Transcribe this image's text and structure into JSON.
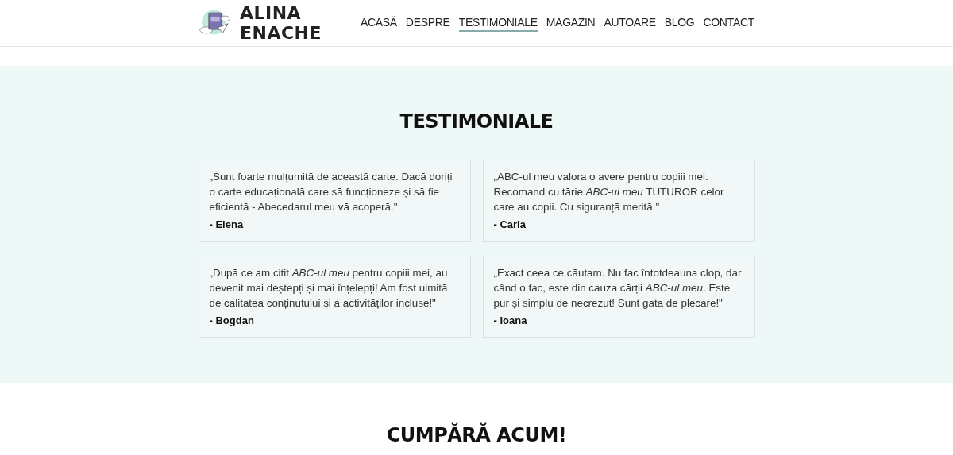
{
  "header": {
    "logo_text": "ALINA ENACHE",
    "nav": [
      {
        "label": "ACASĂ",
        "selected": false
      },
      {
        "label": "DESPRE",
        "selected": false
      },
      {
        "label": "TESTIMONIALE",
        "selected": true
      },
      {
        "label": "MAGAZIN",
        "selected": false
      },
      {
        "label": "AUTOARE",
        "selected": false
      },
      {
        "label": "BLOG",
        "selected": false
      },
      {
        "label": "CONTACT",
        "selected": false
      }
    ]
  },
  "testimonials": {
    "title": "TESTIMONIALE",
    "items": [
      {
        "quote": "„Sunt foarte mulțumită de această carte. Dacă doriți o carte educațională care să funcționeze și să fie eficientă - Abecedarul meu vă acoperă.\"",
        "author": "- Elena"
      },
      {
        "quote": "„ABC-ul meu valora o avere pentru copiii mei. Recomand cu tărie *ABC-ul meu* TUTUROR celor care au copii. Cu siguranță merită.\"",
        "author": "- Carla"
      },
      {
        "quote": "„După ce am citit *ABC-ul meu* pentru copiii mei, au devenit mai deștepți și mai înțelepți! Am fost uimită de calitatea conținutului și a activităților incluse!\"",
        "author": "- Bogdan"
      },
      {
        "quote": "„Exact ceea ce căutam. Nu fac întotdeauna clop, dar când o fac, este din cauza cărții *ABC-ul meu*. Este pur și simplu de necrezut! Sunt gata de plecare!\"",
        "author": "- Ioana"
      }
    ]
  },
  "buy": {
    "title": "CUMPĂRĂ ACUM!"
  }
}
